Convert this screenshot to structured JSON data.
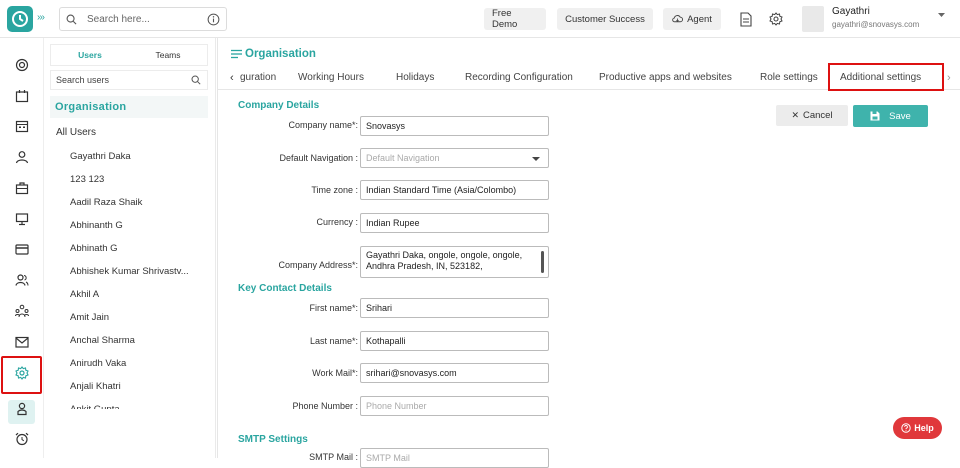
{
  "header": {
    "search_placeholder": "Search here...",
    "free_demo": "Free Demo",
    "customer_success": "Customer Success",
    "agent": "Agent",
    "user_name": "Gayathri",
    "user_email": "gayathri@snovasys.com"
  },
  "userpanel": {
    "tabs": [
      "Users",
      "Teams"
    ],
    "search_placeholder": "Search users",
    "org_heading": "Organisation",
    "all_users": "All Users",
    "users": [
      "Gayathri Daka",
      "123 123",
      "Aadil Raza Shaik",
      "Abhinanth G",
      "Abhinath G",
      "Abhishek Kumar Shrivastv...",
      "Akhil A",
      "Amit Jain",
      "Anchal Sharma",
      "Anirudh Vaka",
      "Anjali Khatri",
      "Ankit Gupta"
    ]
  },
  "main": {
    "title": "Organisation",
    "tabs": [
      "guration",
      "Working Hours",
      "Holidays",
      "Recording Configuration",
      "Productive apps and websites",
      "Role settings",
      "Additional settings"
    ],
    "cancel_label": "Cancel",
    "save_label": "Save",
    "help_label": "Help",
    "company": {
      "heading": "Company Details",
      "name_label": "Company name*:",
      "name_value": "Snovasys",
      "nav_label": "Default Navigation :",
      "nav_placeholder": "Default Navigation",
      "tz_label": "Time zone :",
      "tz_value": "Indian Standard Time (Asia/Colombo)",
      "currency_label": "Currency :",
      "currency_value": "Indian Rupee",
      "address_label": "Company Address*:",
      "address_value": "Gayathri Daka, ongole, ongole, ongole, Andhra Pradesh, IN, 523182,"
    },
    "contact": {
      "heading": "Key Contact Details",
      "first_label": "First name*:",
      "first_value": "Srihari",
      "last_label": "Last name*:",
      "last_value": "Kothapalli",
      "mail_label": "Work Mail*:",
      "mail_value": "srihari@snovasys.com",
      "phone_label": "Phone Number :",
      "phone_placeholder": "Phone Number"
    },
    "smtp": {
      "heading": "SMTP Settings",
      "mail_label": "SMTP Mail :",
      "mail_placeholder": "SMTP Mail"
    }
  },
  "colors": {
    "accent": "#2aa5a0",
    "highlight": "#dd1111",
    "help": "#e0383b"
  }
}
